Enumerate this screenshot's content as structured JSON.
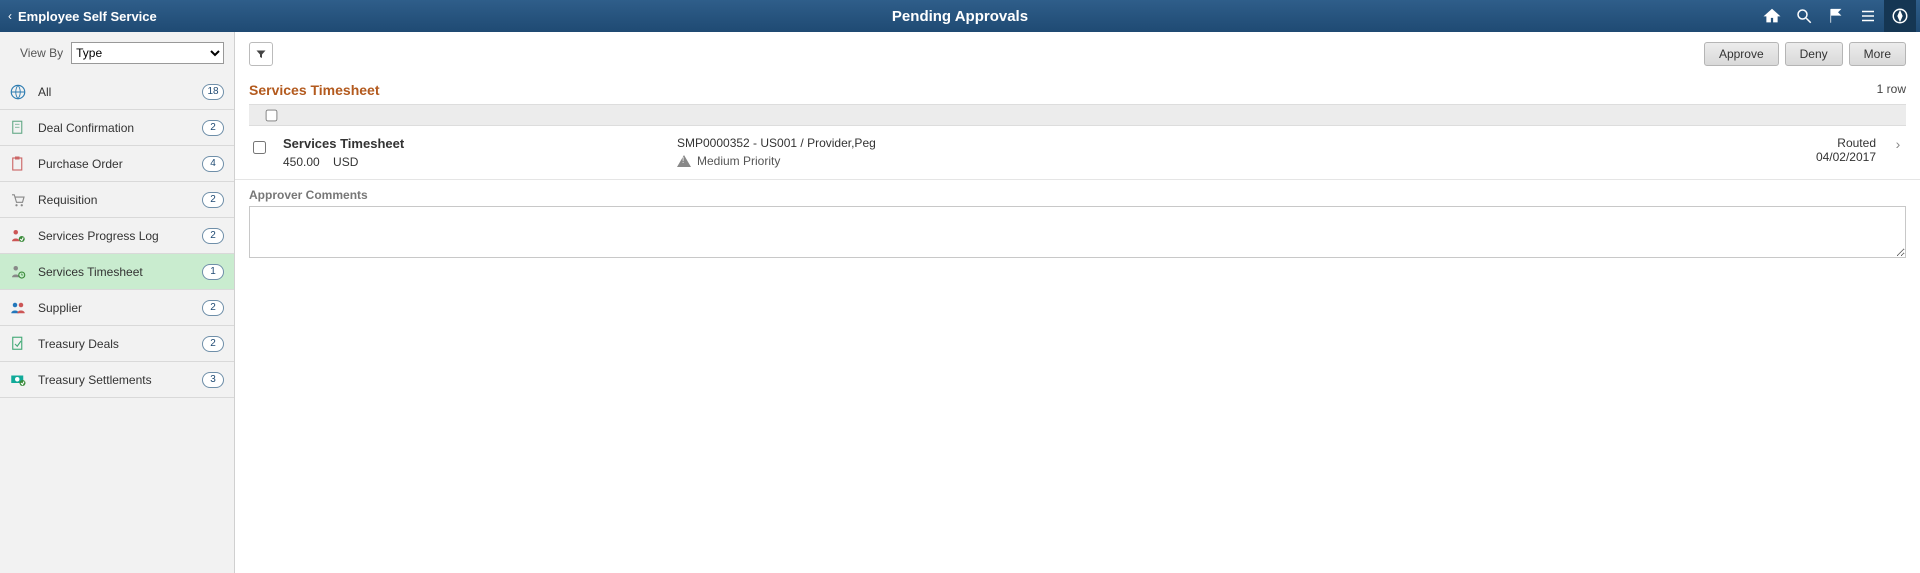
{
  "header": {
    "back_label": "Employee Self Service",
    "page_title": "Pending Approvals"
  },
  "sidebar": {
    "viewby_label": "View By",
    "viewby_value": "Type",
    "viewby_options": [
      "Type"
    ],
    "items": [
      {
        "label": "All",
        "count": "18"
      },
      {
        "label": "Deal Confirmation",
        "count": "2"
      },
      {
        "label": "Purchase Order",
        "count": "4"
      },
      {
        "label": "Requisition",
        "count": "2"
      },
      {
        "label": "Services Progress Log",
        "count": "2"
      },
      {
        "label": "Services Timesheet",
        "count": "1"
      },
      {
        "label": "Supplier",
        "count": "2"
      },
      {
        "label": "Treasury Deals",
        "count": "2"
      },
      {
        "label": "Treasury Settlements",
        "count": "3"
      }
    ],
    "selected_index": 5
  },
  "actions": {
    "approve": "Approve",
    "deny": "Deny",
    "more": "More"
  },
  "section": {
    "title": "Services Timesheet",
    "row_count_label": "1 row"
  },
  "row": {
    "name": "Services Timesheet",
    "amount": "450.00",
    "currency": "USD",
    "reference": "SMP0000352 - US001 / Provider,Peg",
    "priority_label": "Medium Priority",
    "status": "Routed",
    "date": "04/02/2017"
  },
  "comments": {
    "label": "Approver Comments",
    "value": ""
  }
}
